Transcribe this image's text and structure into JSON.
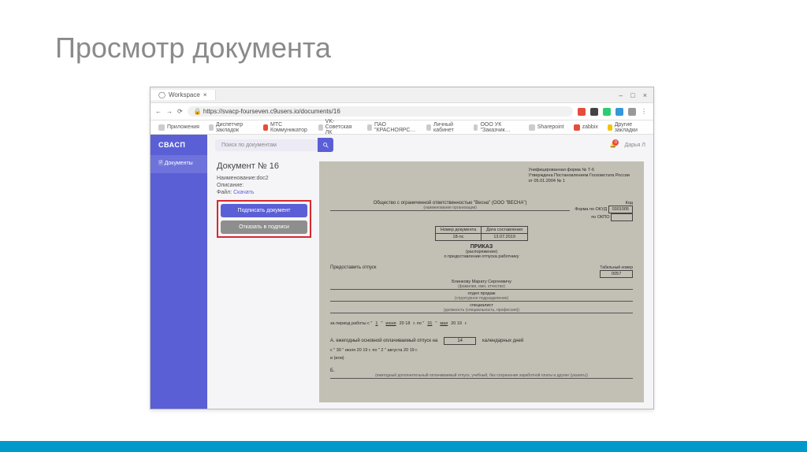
{
  "slide": {
    "title": "Просмотр документа"
  },
  "browser": {
    "tab_title": "Workspace",
    "url": "https://svacp-fourseven.c9users.io/documents/16",
    "window_controls": {
      "min": "–",
      "max": "□",
      "close": "×"
    },
    "nav": {
      "back": "←",
      "fwd": "→",
      "reload": "⟳"
    },
    "bookmarks": {
      "apps": "Приложения",
      "items": [
        "Диспетчер закладок",
        "МТС Коммуникатор",
        "VK-Советская ЛК",
        "ПАО \"КРАСНОЯРС…",
        "Личный кабинет",
        "ООО УК \"Заказчик…",
        "Sharepoint",
        "zabbix"
      ],
      "more": "Другие закладки"
    }
  },
  "app": {
    "logo": "СВАСП",
    "sidebar": {
      "item1": "Документы"
    },
    "search_placeholder": "Поиск по документам",
    "notif_count": "0",
    "user": "Дарья Л"
  },
  "doc": {
    "title": "Документ № 16",
    "name_label": "Наименование:",
    "name_value": "doc2",
    "desc_label": "Описание:",
    "file_label": "Файл:",
    "file_link": "Скачать",
    "btn_sign": "Подписать документ",
    "btn_reject": "Отказать в подписи"
  },
  "preview": {
    "form_header1": "Унифицированная форма № Т-6",
    "form_header2": "Утверждена Постановлением Госкомстата России",
    "form_header3": "от 05.01.2004 № 1",
    "okud_label": "Форма по ОКУД",
    "okud_code": "0301005",
    "okpo_label": "по ОКПО",
    "kod_label": "Код",
    "org_name": "Общество с ограниченной ответственностью \"Весна\" (ООО \"ВЕСНА\")",
    "org_sub": "(наименование организации)",
    "table_h1": "Номер документа",
    "table_h2": "Дата составления",
    "table_v1": "18-лс",
    "table_v2": "13.07.2019",
    "order_title": "ПРИКАЗ",
    "order_sub1": "(распоряжение)",
    "order_sub2": "о предоставлении отпуска работнику",
    "grant_label": "Предоставить отпуск",
    "tabel_label": "Табельный номер",
    "tabel_value": "0057",
    "employee": "Блинкову Марату Сергеевичу",
    "employee_sub": "(фамилия, имя, отчество)",
    "dept": "отдел продаж",
    "dept_sub": "(структурное подразделение)",
    "position": "специалист",
    "position_sub": "(должность (специальность, профессия))",
    "period_prefix": "за период работы с \"",
    "period_d1": "1",
    "period_m1": "июня",
    "period_y1": "20 18",
    "period_mid": "г. по \"",
    "period_d2": "31",
    "period_m2": "мая",
    "period_y2": "20 19",
    "period_suffix": "г.",
    "sectA": "А. ежегодный основной оплачиваемый отпуск на",
    "sectA_days": "14",
    "sectA_suffix": "календарных дней",
    "dateA_from": "с \" 30 \"   июля   20 19 г. по \" 2 \"   августа   20 19 г.",
    "or": "и (или)",
    "sectB": "Б.",
    "sectB_sub": "(ежегодный дополнительный оплачиваемый отпуск, учебный, без сохранения заработной платы и другие (указать))"
  }
}
